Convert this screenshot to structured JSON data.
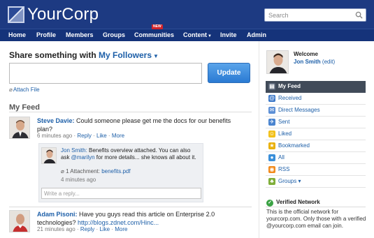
{
  "header": {
    "logo_text": "YourCorp",
    "search_placeholder": "Search"
  },
  "nav": {
    "home": "Home",
    "profile": "Profile",
    "members": "Members",
    "groups": "Groups",
    "communities": "Communities",
    "communities_badge": "NEW",
    "content": "Content",
    "invite": "Invite",
    "admin": "Admin"
  },
  "share": {
    "prefix": "Share something with ",
    "audience": "My Followers",
    "button": "Update",
    "attach": "Attach File"
  },
  "feed": {
    "title": "My Feed",
    "posts": [
      {
        "author": "Steve Davie:",
        "body": " Could someone please get me the docs for our benefits plan?",
        "time": "6 minutes ago",
        "reply": "Reply",
        "like": "Like",
        "more": "More",
        "sep": "·"
      },
      {
        "author": "Adam Pisoni:",
        "body": " Have you guys read this article on Enterprise 2.0 technologies? ",
        "link": "http://blogs.zdnet.com/Hinc...",
        "time": "21 minutes ago",
        "reply": "Reply",
        "like": "Like",
        "more": "More",
        "sep": "·"
      }
    ],
    "reply": {
      "author": "Jon Smith:",
      "body_before": " Benefits overview attached. You can also ask ",
      "mention": "@marilyn",
      "body_after": " for more details... she knows all about it.",
      "attachment_label": "1 Attachment: ",
      "attachment_file": "benefits.pdf",
      "time": "4 minutes ago",
      "input_placeholder": "Write a reply..."
    }
  },
  "sidebar": {
    "welcome": "Welcome",
    "user_name": "Jon Smith",
    "edit": "(edit)",
    "menu": [
      {
        "label": "My Feed",
        "icon": "feed-icon",
        "color": "#5a6577"
      },
      {
        "label": "Received",
        "icon": "at-icon",
        "color": "#3c78c8"
      },
      {
        "label": "Direct Messages",
        "icon": "envelope-icon",
        "color": "#5c8fd6"
      },
      {
        "label": "Sent",
        "icon": "sent-icon",
        "color": "#4a84cf"
      },
      {
        "label": "Liked",
        "icon": "smiley-icon",
        "color": "#f2c11b"
      },
      {
        "label": "Bookmarked",
        "icon": "star-icon",
        "color": "#e9b10e"
      },
      {
        "label": "All",
        "icon": "globe-icon",
        "color": "#3a8fd9"
      },
      {
        "label": "RSS",
        "icon": "rss-icon",
        "color": "#f28a1b"
      },
      {
        "label": "Groups ▾",
        "icon": "groups-icon",
        "color": "#7fae3a"
      }
    ],
    "verified_title": "Verified Network",
    "verified_text": "This is the official network for yourcorp.com. Only those with a verified @yourcorp.com email can join."
  }
}
